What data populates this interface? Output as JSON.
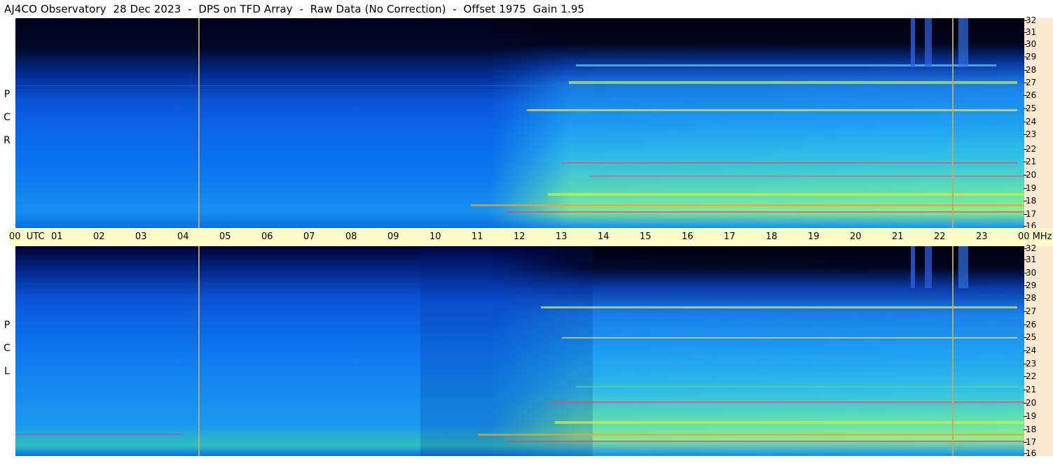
{
  "header": {
    "title": "AJ4CO Observatory  28 Dec 2023  -  DPS on TFD Array  -  Raw Data (No Correction)  -  Offset 1975  Gain 1.95"
  },
  "panels": [
    {
      "name": "RCP",
      "label_letters": [
        "R",
        "C",
        "P"
      ]
    },
    {
      "name": "LCP",
      "label_letters": [
        "L",
        "C",
        "P"
      ]
    }
  ],
  "time_axis": {
    "labels": [
      "00  UTC",
      "01",
      "02",
      "03",
      "04",
      "05",
      "06",
      "07",
      "08",
      "09",
      "10",
      "11",
      "12",
      "13",
      "14",
      "15",
      "16",
      "17",
      "18",
      "19",
      "20",
      "21",
      "22",
      "23",
      "00 MHz"
    ]
  },
  "freq_axis": {
    "labels": [
      "32",
      "31",
      "30",
      "29",
      "28",
      "27",
      "26",
      "25",
      "24",
      "23",
      "22",
      "21",
      "20",
      "19",
      "18",
      "17",
      "16"
    ]
  },
  "colors": {
    "time_bar": "#fdfbc8",
    "freq_strip": "#fde8d2",
    "marker_line": "#c9a85a"
  }
}
